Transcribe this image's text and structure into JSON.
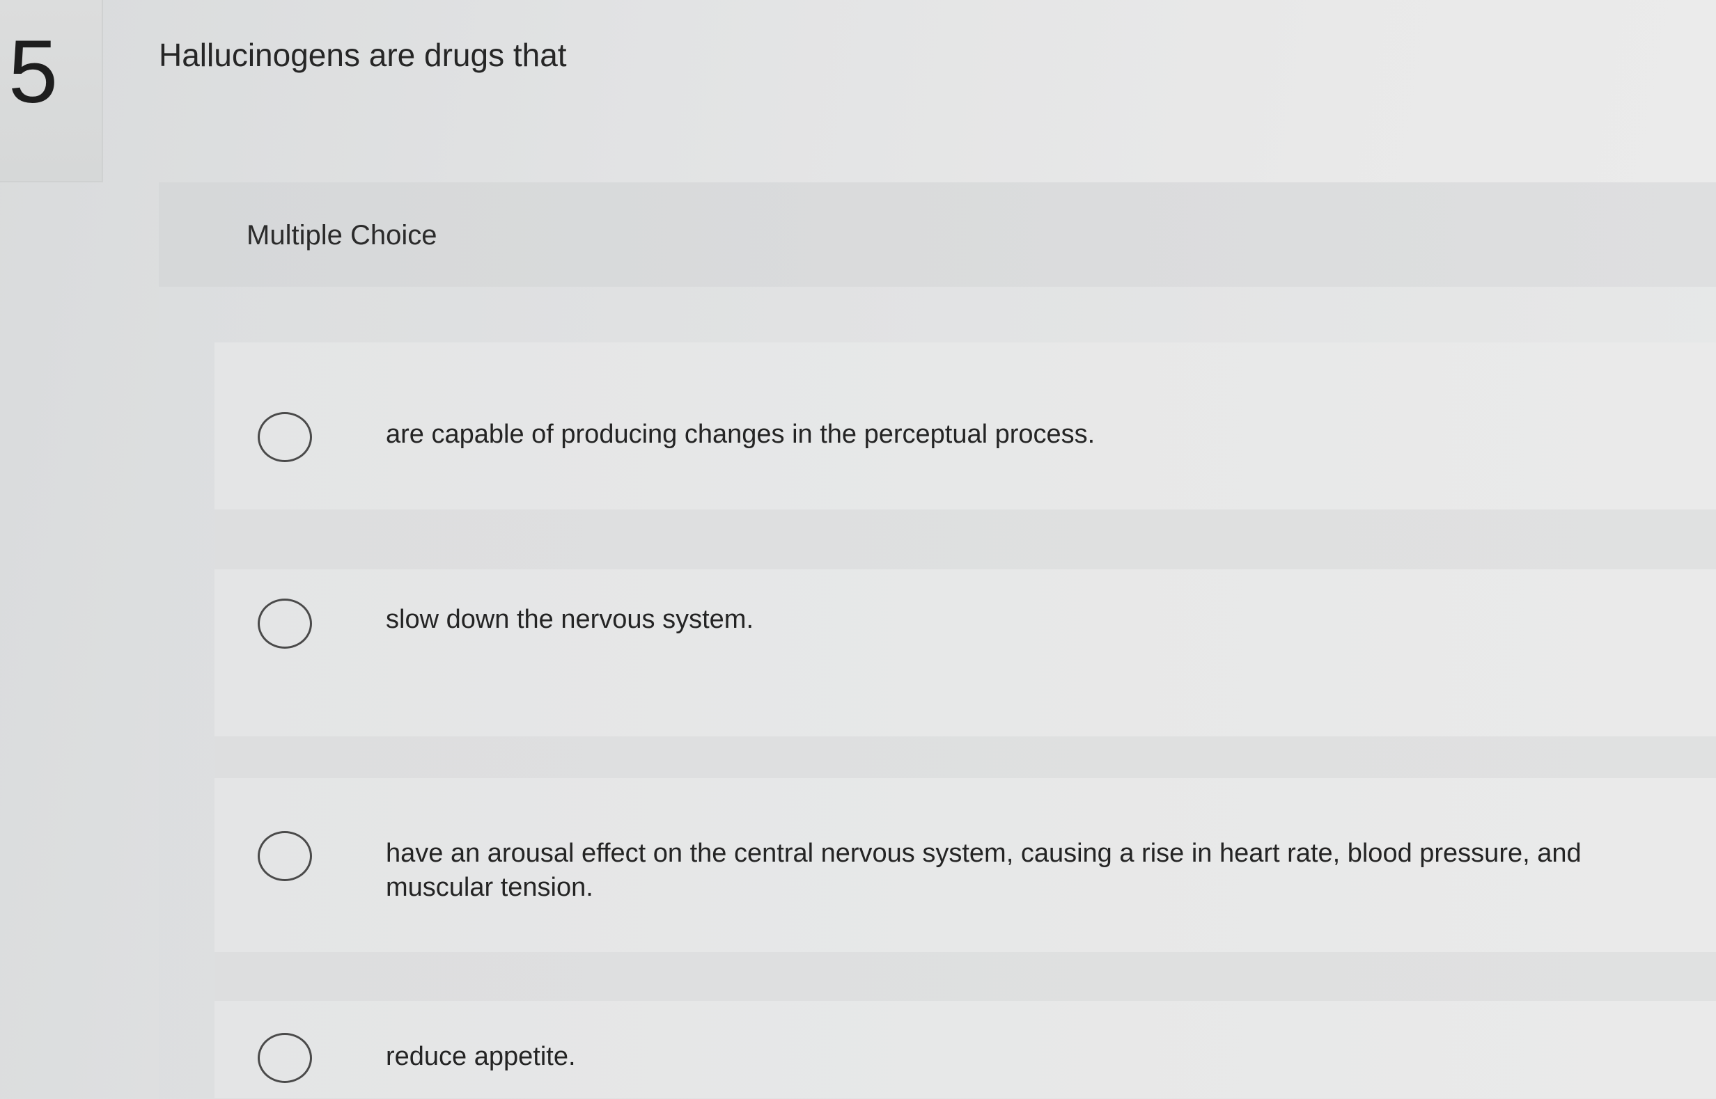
{
  "question": {
    "number": "5",
    "prompt": "Hallucinogens are drugs that",
    "type_label": "Multiple Choice"
  },
  "options": [
    {
      "text": "are capable of producing changes in the perceptual process.",
      "selected": false
    },
    {
      "text": "slow down the nervous system.",
      "selected": false
    },
    {
      "text": "have an arousal effect on the central nervous system, causing a rise in heart rate, blood pressure, and muscular tension.",
      "selected": false
    },
    {
      "text": "reduce appetite.",
      "selected": false
    }
  ],
  "colors": {
    "background": "#e6e7e7",
    "radio_border": "#4a4a4a",
    "text": "#262626"
  }
}
